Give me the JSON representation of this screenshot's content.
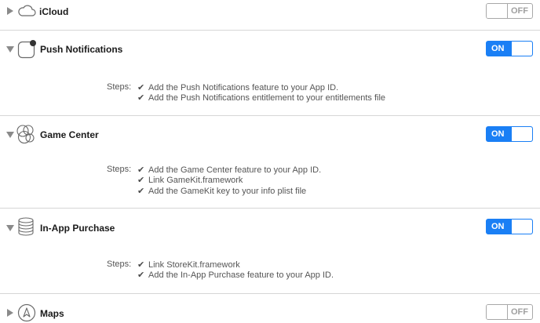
{
  "capabilities": [
    {
      "title": "iCloud",
      "expanded": false,
      "toggle": "OFF",
      "icon": "cloud-icon",
      "steps_label": "",
      "steps": []
    },
    {
      "title": "Push Notifications",
      "expanded": true,
      "toggle": "ON",
      "icon": "push-notifications-icon",
      "steps_label": "Steps:",
      "steps": [
        {
          "check": "✔",
          "text": "Add the Push Notifications feature to your App ID."
        },
        {
          "check": "✔",
          "text": "Add the Push Notifications entitlement to your entitlements file"
        }
      ]
    },
    {
      "title": "Game Center",
      "expanded": true,
      "toggle": "ON",
      "icon": "game-center-icon",
      "steps_label": "Steps:",
      "steps": [
        {
          "check": "✔",
          "text": "Add the Game Center feature to your App ID."
        },
        {
          "check": "✔",
          "text": "Link GameKit.framework"
        },
        {
          "check": "✔",
          "text": "Add the GameKit key to your info plist file"
        }
      ]
    },
    {
      "title": "In-App Purchase",
      "expanded": true,
      "toggle": "ON",
      "icon": "in-app-purchase-icon",
      "steps_label": "Steps:",
      "steps": [
        {
          "check": "✔",
          "text": "Link StoreKit.framework"
        },
        {
          "check": "✔",
          "text": "Add the In-App Purchase feature to your App ID."
        }
      ]
    },
    {
      "title": "Maps",
      "expanded": false,
      "toggle": "OFF",
      "icon": "maps-icon",
      "steps_label": "",
      "steps": []
    }
  ],
  "colors": {
    "toggle_on": "#1a7ff5",
    "divider": "#d6d6d6"
  }
}
